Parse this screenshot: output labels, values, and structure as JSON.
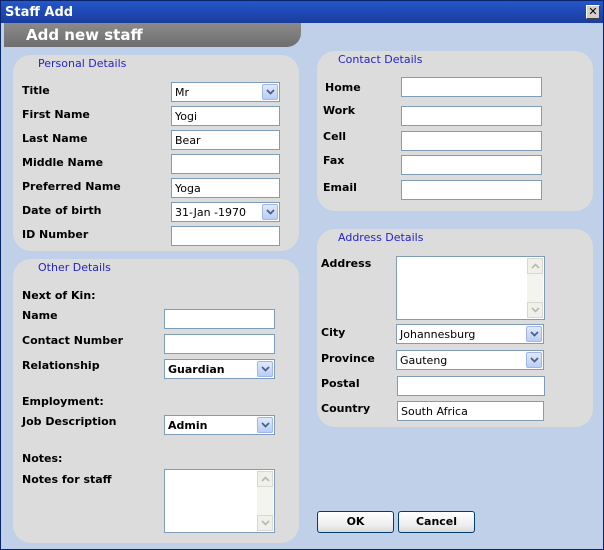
{
  "window": {
    "title": "Staff Add",
    "close_glyph": "✕"
  },
  "header": {
    "title": "Add new staff"
  },
  "personal": {
    "section_title": "Personal Details",
    "title_label": "Title",
    "title_value": "Mr",
    "first_name_label": "First Name",
    "first_name_value": "Yogi",
    "last_name_label": "Last Name",
    "last_name_value": "Bear",
    "middle_name_label": "Middle Name",
    "middle_name_value": "",
    "preferred_name_label": "Preferred Name",
    "preferred_name_value": "Yoga",
    "dob_label": "Date of birth",
    "dob_value": "31-Jan -1970",
    "id_label": "ID Number",
    "id_value": ""
  },
  "other": {
    "section_title": "Other Details",
    "next_of_kin_label": "Next of Kin:",
    "name_label": "Name",
    "name_value": "",
    "contact_number_label": "Contact Number",
    "contact_number_value": "",
    "relationship_label": "Relationship",
    "relationship_value": "Guardian",
    "employment_label": "Employment:",
    "job_description_label": "Job Description",
    "job_description_value": "Admin",
    "notes_label": "Notes:",
    "notes_for_staff_label": "Notes for staff",
    "notes_value": ""
  },
  "contact": {
    "section_title": "Contact Details",
    "home_label": "Home",
    "home_value": "",
    "work_label": "Work",
    "work_value": "",
    "cell_label": "Cell",
    "cell_value": "",
    "fax_label": "Fax",
    "fax_value": "",
    "email_label": "Email",
    "email_value": ""
  },
  "address": {
    "section_title": "Address Details",
    "address_label": "Address",
    "address_value": "",
    "city_label": "City",
    "city_value": "Johannesburg",
    "province_label": "Province",
    "province_value": "Gauteng",
    "postal_label": "Postal",
    "postal_value": "",
    "country_label": "Country",
    "country_value": "South Africa"
  },
  "buttons": {
    "ok_label": "OK",
    "cancel_label": "Cancel"
  },
  "colors": {
    "titlebar": "#1e46b0",
    "background": "#bfd0e8",
    "panel": "#dcdcdc",
    "section_title": "#2424c8"
  }
}
